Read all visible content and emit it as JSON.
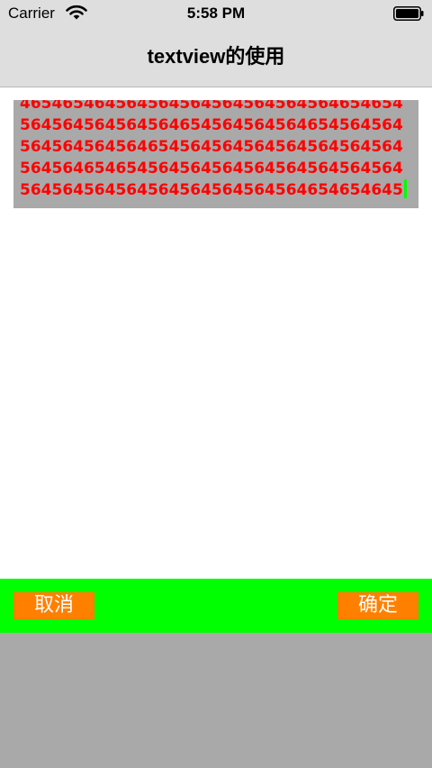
{
  "status_bar": {
    "carrier": "Carrier",
    "time": "5:58 PM",
    "wifi_icon": "wifi-icon",
    "battery_icon": "battery-icon"
  },
  "nav": {
    "title": "textview的使用"
  },
  "text_view": {
    "content": "465465464564564564564564564564654654564564564564564654564564564654564564564564564564654564564564564564564564564564654654564564564564564564564564564564564564564564564564564654654645",
    "lines": [
      "4654654645645645645645645645646546546545 6",
      "45645645645646545645645646545645645",
      "64564564564564564654564564564564564564",
      "56465465456456456456456456456456456456",
      "456456465465464"
    ],
    "background_color": "#a9a9a9",
    "text_color": "#ff0000",
    "caret_color": "#00ff00"
  },
  "toolbar": {
    "background_color": "#00ff00",
    "cancel_label": "取消",
    "confirm_label": "确定",
    "button_color": "#ff8000"
  },
  "bottom_panel": {
    "background_color": "#a9a9a9"
  }
}
